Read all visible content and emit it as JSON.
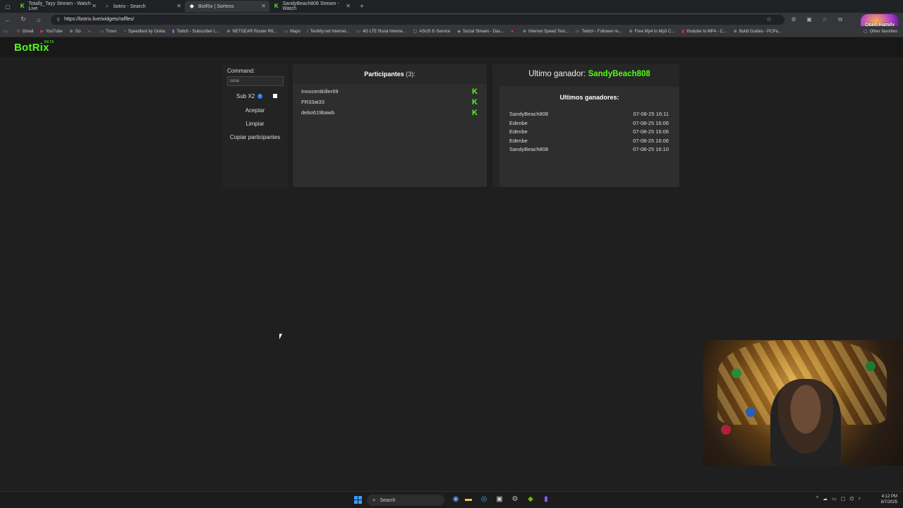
{
  "browser": {
    "tabs": [
      {
        "title": "Totally_Tayy Stream - Watch Live",
        "icon": "kick-icon"
      },
      {
        "title": "botrix - Search",
        "icon": "search-icon"
      },
      {
        "title": "BotRix | Sorteos",
        "icon": "botrix-icon",
        "active": true
      },
      {
        "title": "SandyBeach808 Stream - Watch",
        "icon": "kick-icon"
      }
    ],
    "url": "https://botrix.live/widgets/raffles/",
    "profile_label": "Open Family",
    "bookmarks": [
      "Gmail",
      "YouTube",
      "Go",
      "",
      "Trovo",
      "Speedtest by Ookla",
      "Twitch - Subscriber L...",
      "NETGEAR Router R6...",
      "Maps",
      "TestMy.net Internet...",
      "4G LTE Rural Interne...",
      "ASUS E-Service",
      "Social Stream - Das...",
      "",
      "Internet Speed Test...",
      "Twitch - Follower re...",
      "Free Mp4 to Mp3 C...",
      "Youtube to MP4 - C...",
      "Build Guides - PCPa..."
    ],
    "other_favorites": "Other favorites"
  },
  "app": {
    "logo": "BotRix",
    "logo_badge": "BETA"
  },
  "controls": {
    "command_label": "Command:",
    "command_value": "sosa",
    "sub_label": "Sub X2",
    "sub_checked": true,
    "accept_label": "Aceptar",
    "clear_label": "Limpiar",
    "copy_label": "Copiar participantes"
  },
  "participants": {
    "title": "Participantes",
    "count": "(3):",
    "items": [
      "Innocentkiller69",
      "FR33at33",
      "debo619bawb"
    ]
  },
  "winner": {
    "label": "Ultimo ganador:",
    "name": "SandyBeach808",
    "list_title": "Ultimos ganadores:",
    "list": [
      {
        "name": "SandyBeach808",
        "date": "07-08-25 16:11"
      },
      {
        "name": "Edenbe",
        "date": "07-08-25 16:06"
      },
      {
        "name": "Edenbe",
        "date": "07-08-25 16:06"
      },
      {
        "name": "Edenbe",
        "date": "07-08-25 16:06"
      },
      {
        "name": "SandyBeach808",
        "date": "07-08-25 16:10"
      }
    ]
  },
  "taskbar": {
    "search_placeholder": "Search",
    "time": "4:12 PM",
    "date": "8/7/2025"
  },
  "colors": {
    "accent": "#53fc18",
    "background": "#1f1f1f"
  }
}
